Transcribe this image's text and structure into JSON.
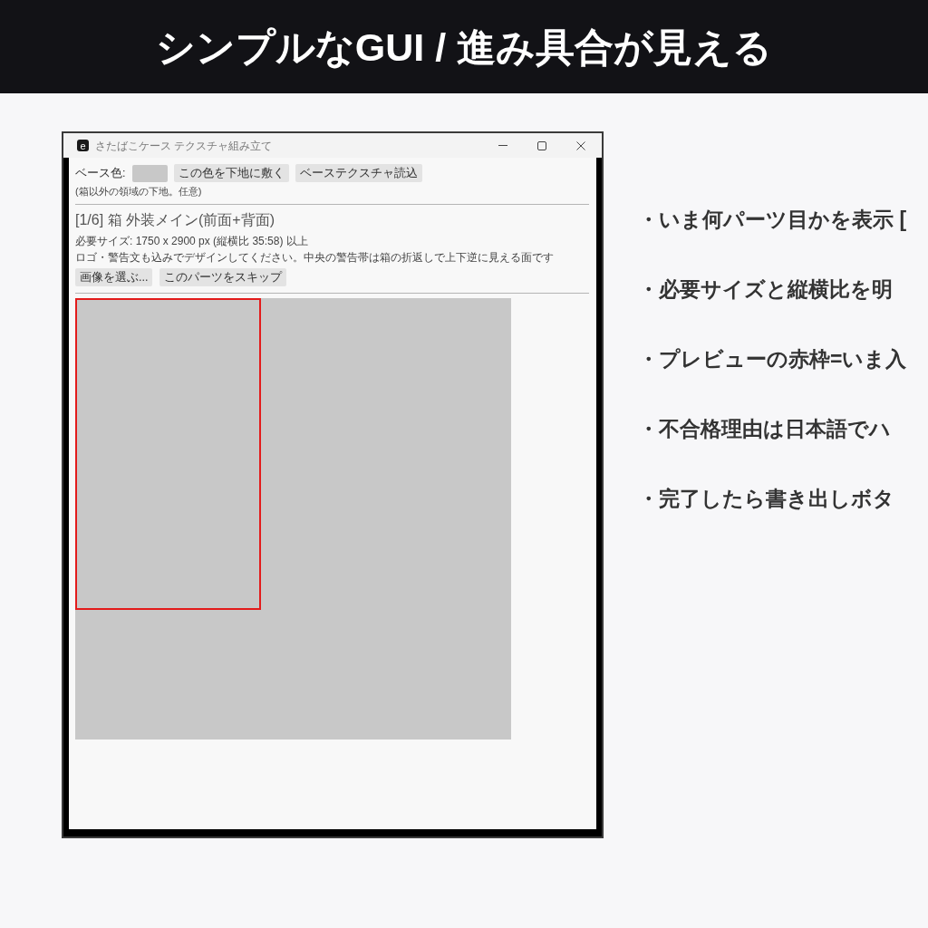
{
  "header": {
    "title": "シンプルなGUI / 進み具合が見える"
  },
  "window": {
    "app_icon": "e",
    "title": "さたばこケース テクスチャ組み立て"
  },
  "base_row": {
    "label": "ベース色:",
    "swatch": {
      "color": "#c8c8c8"
    },
    "buttons": [
      "この色を下地に敷く",
      "ベーステクスチャ読込"
    ],
    "note": "(箱以外の領域の下地。任意)"
  },
  "part": {
    "heading": "[1/6] 箱 外装メイン(前面+背面)",
    "size": "必要サイズ: 1750 x 2900 px (縦横比 35:58) 以上",
    "note": "ロゴ・警告文も込みでデザインしてください。中央の警告帯は箱の折返しで上下逆に見える面です",
    "buttons": [
      "画像を選ぶ...",
      "このパーツをスキップ"
    ]
  },
  "bullets": [
    "・いま何パーツ目かを表示 [",
    "・必要サイズと縦横比を明",
    "・プレビューの赤枠=いま入",
    "・不合格理由は日本語でハ",
    "・完了したら書き出しボタ"
  ]
}
